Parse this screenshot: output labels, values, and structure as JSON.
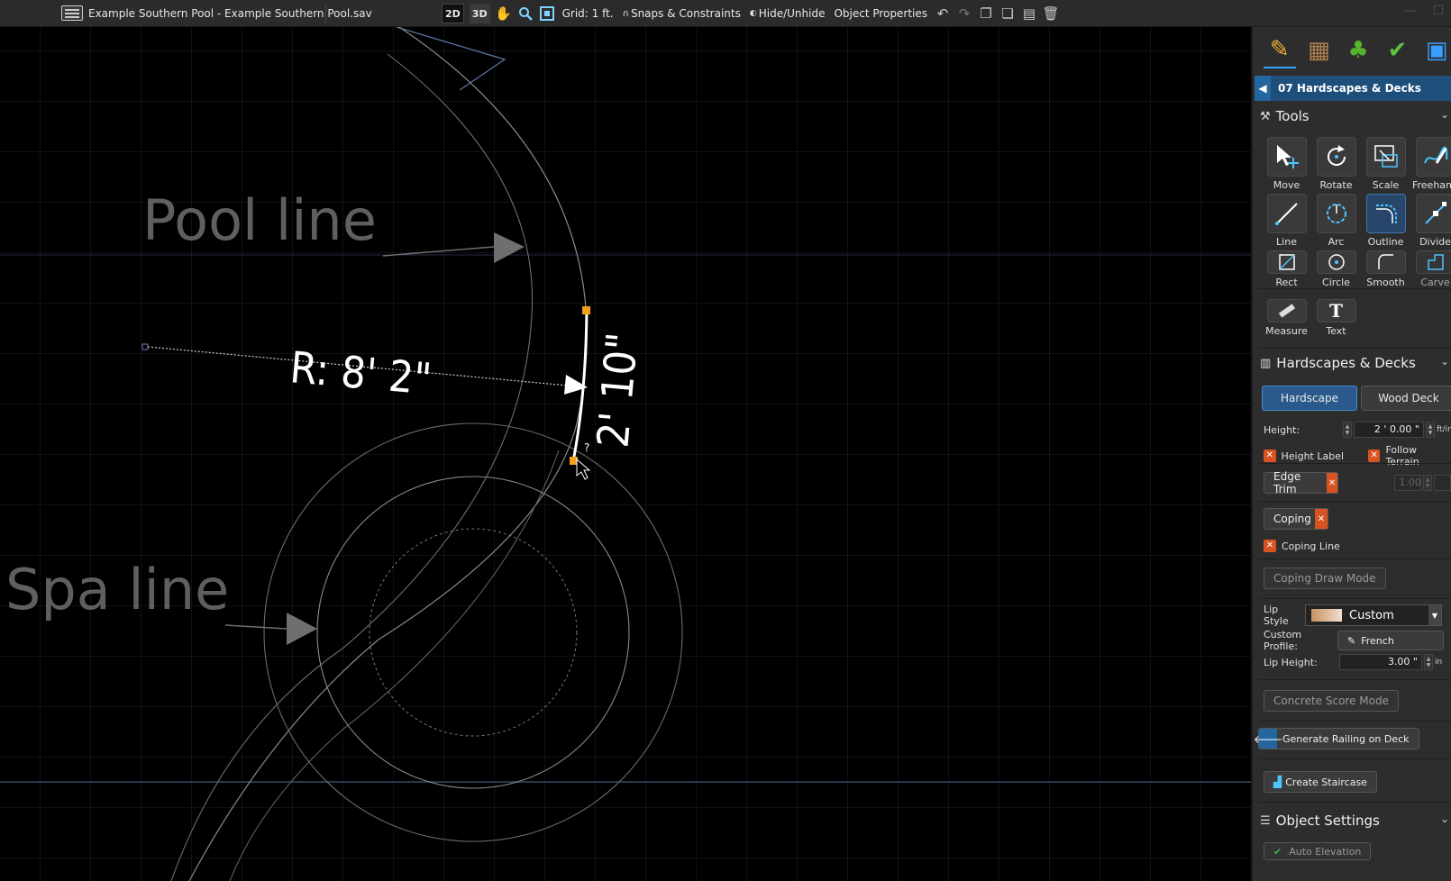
{
  "titlebar": {
    "file_title": "Example Southern Pool - Example Southern Pool.sav"
  },
  "toolbar": {
    "view_2d": "2D",
    "view_3d": "3D",
    "grid_label": "Grid: 1 ft.",
    "snaps_label": "Snaps & Constraints",
    "hide_label": "Hide/Unhide",
    "object_properties_label": "Object Properties"
  },
  "canvas": {
    "pool_line_label": "Pool line",
    "spa_line_label": "Spa line",
    "radius_dimension": "R: 8' 2\"",
    "arc_length_dimension": "2' 10\"",
    "cursor_hint": "?"
  },
  "panel": {
    "category_icons": [
      "pencil-icon",
      "bricks-icon",
      "plant-icon",
      "check-icon",
      "landscape-icon"
    ],
    "breadcrumb": "07 Hardscapes & Decks",
    "tools_header": "Tools",
    "tools": [
      {
        "label": "Move",
        "icon": "move-icon"
      },
      {
        "label": "Rotate",
        "icon": "rotate-icon"
      },
      {
        "label": "Scale",
        "icon": "scale-icon"
      },
      {
        "label": "Freehand",
        "icon": "freehand-icon"
      },
      {
        "label": "Line",
        "icon": "line-icon"
      },
      {
        "label": "Arc",
        "icon": "arc-icon"
      },
      {
        "label": "Outline",
        "icon": "outline-icon"
      },
      {
        "label": "Divide",
        "icon": "divide-icon"
      },
      {
        "label": "Rect",
        "icon": "rect-icon"
      },
      {
        "label": "Circle",
        "icon": "circle-icon"
      },
      {
        "label": "Smooth",
        "icon": "smooth-icon"
      },
      {
        "label": "Carve",
        "icon": "carve-icon"
      },
      {
        "label": "Measure",
        "icon": "measure-icon"
      },
      {
        "label": "Text",
        "icon": "text-icon"
      }
    ],
    "hardscapes_header": "Hardscapes & Decks",
    "mode_hardscape": "Hardscape",
    "mode_wood_deck": "Wood Deck",
    "height_label": "Height:",
    "height_value": "2 ' 0.00 \"",
    "height_unit": "ft/in",
    "height_label_check": "Height Label",
    "follow_terrain_check": "Follow Terrain",
    "edge_trim_label": "Edge Trim",
    "edge_trim_value": "1.00",
    "coping_label": "Coping",
    "coping_line_check": "Coping Line",
    "coping_draw_mode": "Coping Draw Mode",
    "lip_style_label": "Lip Style",
    "lip_style_value": "Custom",
    "custom_profile_label": "Custom Profile:",
    "custom_profile_value": "French",
    "lip_height_label": "Lip Height:",
    "lip_height_value": "3.00 \"",
    "lip_height_unit": "in",
    "concrete_score_mode": "Concrete Score Mode",
    "generate_railing": "Generate Railing on Deck",
    "create_staircase": "Create Staircase",
    "object_settings_header": "Object Settings",
    "auto_elevation": "Auto Elevation"
  },
  "colors": {
    "accent_blue": "#2a5a8c",
    "orange_x": "#d8531f",
    "handle_orange": "#f0a020",
    "grid_line": "#1b2230"
  }
}
